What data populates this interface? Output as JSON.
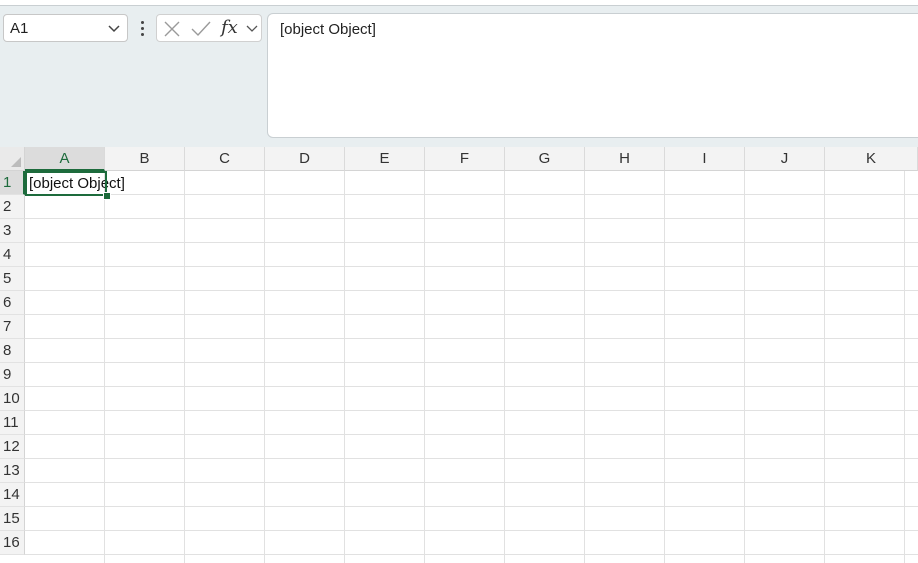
{
  "name_box": {
    "value": "A1"
  },
  "formula_bar": {
    "content": "[object Object]",
    "fx_label": "fx"
  },
  "sheet": {
    "columns": [
      "A",
      "B",
      "C",
      "D",
      "E",
      "F",
      "G",
      "H",
      "I",
      "J",
      "K"
    ],
    "rows": [
      "1",
      "2",
      "3",
      "4",
      "5",
      "6",
      "7",
      "8",
      "9",
      "10",
      "11",
      "12",
      "13",
      "14",
      "15",
      "16"
    ],
    "active_cell": "A1",
    "cells": {
      "A1": "[object Object]"
    }
  },
  "colors": {
    "accent": "#1d6b3c",
    "header_bg": "#f3f3f3",
    "gridline": "#e1e1e1"
  }
}
